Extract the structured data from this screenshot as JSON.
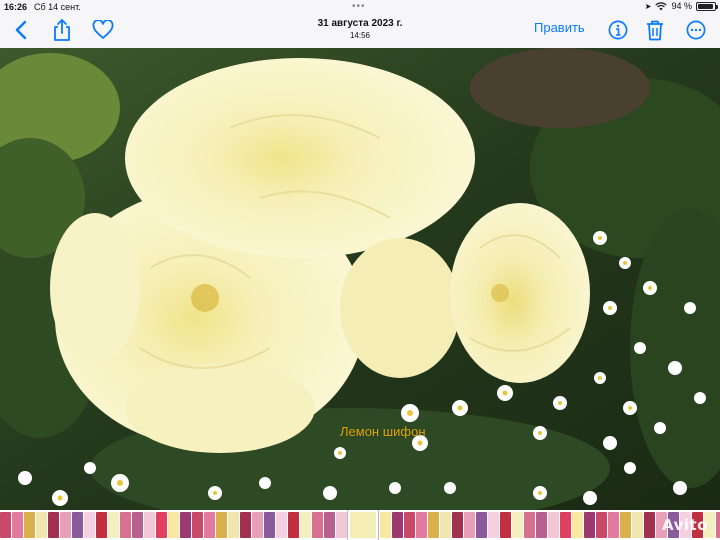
{
  "status_bar": {
    "time": "16:26",
    "date": "Сб 14 сент.",
    "battery_percent": "94 %",
    "battery_level": 0.94
  },
  "toolbar": {
    "date": "31 августа 2023 г.",
    "time": "14:56",
    "edit_label": "Править",
    "accent_color": "#0a7aff",
    "icons": [
      "back-icon",
      "share-icon",
      "heart-icon",
      "info-icon",
      "trash-icon",
      "more-icon"
    ]
  },
  "photo": {
    "caption": "Лемон шифон",
    "caption_color": "#e0a800"
  },
  "watermark": {
    "text": "Avito"
  }
}
